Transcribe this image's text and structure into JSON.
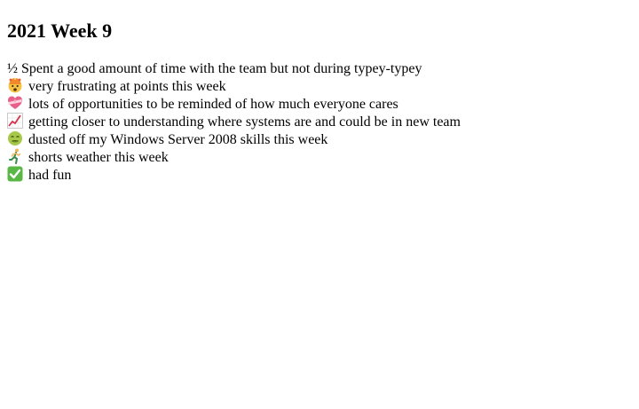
{
  "title": "2021 Week 9",
  "items": [
    {
      "icon": "one-half-symbol",
      "marker": "½",
      "text": "Spent a good amount of time with the team but not during typey-typey"
    },
    {
      "icon": "exploding-head-emoji-icon",
      "text": "very frustrating at points this week"
    },
    {
      "icon": "heart-with-ribbon-emoji-icon",
      "text": "lots of opportunities to be reminded of how much everyone cares"
    },
    {
      "icon": "chart-increasing-emoji-icon",
      "text": "getting closer to understanding where systems are and could be in new team"
    },
    {
      "icon": "nauseated-face-emoji-icon",
      "text": "dusted off my Windows Server 2008 skills this week"
    },
    {
      "icon": "person-running-emoji-icon",
      "text": "shorts weather this week"
    },
    {
      "icon": "check-mark-button-emoji-icon",
      "text": "had fun"
    }
  ]
}
